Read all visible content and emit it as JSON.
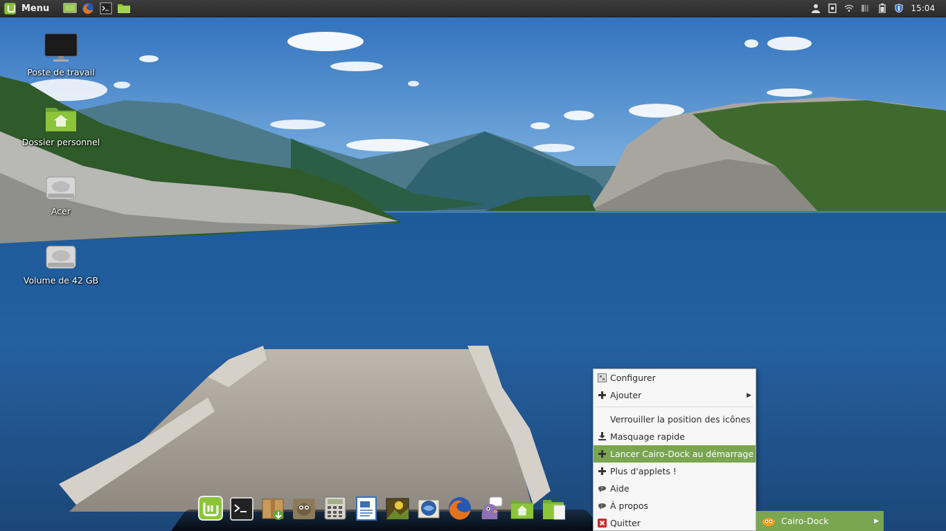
{
  "top_panel": {
    "menu_label": "Menu",
    "launchers": [
      {
        "name": "show-desktop-icon"
      },
      {
        "name": "firefox-icon"
      },
      {
        "name": "terminal-icon"
      },
      {
        "name": "files-icon"
      }
    ],
    "tray": [
      "user-icon",
      "clipboard-icon",
      "wifi-icon",
      "volume-icon",
      "battery-icon",
      "update-shield-icon"
    ],
    "clock": "15:04"
  },
  "desktop": {
    "icons": [
      {
        "label": "Poste de travail",
        "icon": "computer-icon"
      },
      {
        "label": "Dossier personnel",
        "icon": "home-folder-icon"
      },
      {
        "label": "Acer",
        "icon": "drive-icon"
      },
      {
        "label": "Volume de 42 GB",
        "icon": "drive-icon"
      }
    ]
  },
  "dock": {
    "items": [
      "mint-menu-icon",
      "terminal-icon",
      "package-installer-icon",
      "gimp-icon",
      "calculator-icon",
      "writer-icon",
      "image-viewer-icon",
      "thunderbird-icon",
      "firefox-icon",
      "pidgin-icon",
      "home-folder-icon",
      "folder-icon"
    ]
  },
  "context_menu": {
    "items": [
      {
        "label": "Configurer",
        "icon": "configure-icon"
      },
      {
        "label": "Ajouter",
        "icon": "plus-icon",
        "submenu": true
      },
      {
        "label": "Verrouiller la position des icônes",
        "icon": ""
      },
      {
        "label": "Masquage rapide",
        "icon": "hide-down-icon"
      },
      {
        "label": "Lancer Cairo-Dock au démarrage",
        "icon": "plus-icon",
        "active": true
      },
      {
        "label": "Plus d'applets !",
        "icon": "plus-icon"
      },
      {
        "label": "Aide",
        "icon": "help-icon"
      },
      {
        "label": "À propos",
        "icon": "about-icon"
      },
      {
        "label": "Quitter",
        "icon": "quit-icon"
      }
    ]
  },
  "submenu": {
    "label": "Cairo-Dock",
    "icon": "cairo-dock-icon"
  },
  "colors": {
    "menu_highlight": "#7aa551",
    "panel_bg": "#2b2b2b",
    "mint_green": "#8cc43a"
  }
}
